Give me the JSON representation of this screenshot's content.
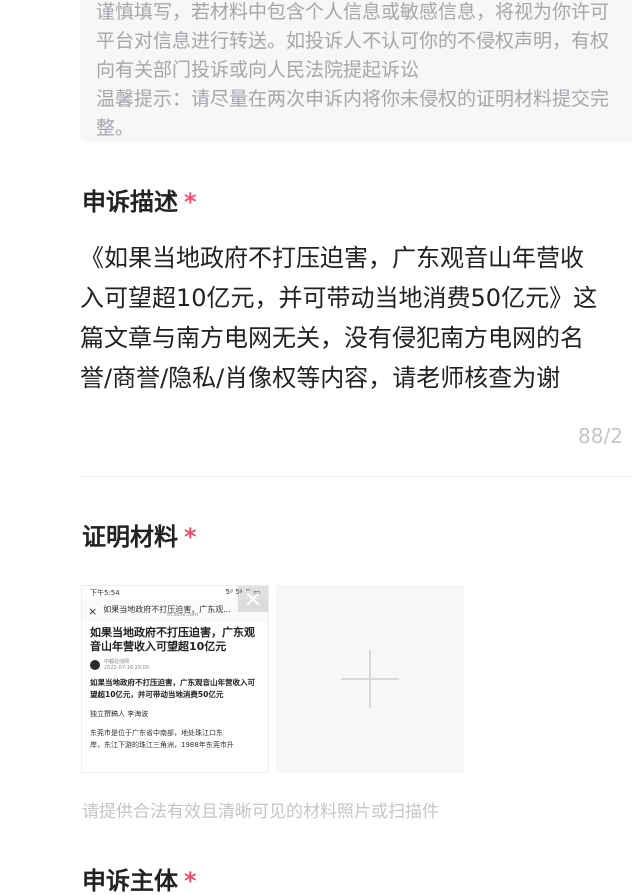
{
  "notice": {
    "lines": [
      "谨慎填写，若材料中包含个人信息或敏感信息，将视为你许可",
      "平台对信息进行转送。如投诉人不认可你的不侵权声明，有权",
      "向有关部门投诉或向人民法院提起诉讼",
      "温馨提示：请尽量在两次申诉内将你未侵权的证明材料提交完",
      "整。"
    ]
  },
  "appeal_description": {
    "title": "申诉描述",
    "required_mark": "*",
    "text_lines": [
      "《如果当地政府不打压迫害，广东观音山年营收",
      "入可望超10亿元，并可带动当地消费50亿元》这",
      "篇文章与南方电网无关，没有侵犯南方电网的名",
      "誉/商誉/隐私/肖像权等内容，请老师核查为谢"
    ],
    "char_counter": "88/2"
  },
  "proof_material": {
    "title": "证明材料",
    "required_mark": "*",
    "thumbnail": {
      "status_time": "下午5:54",
      "status_icons": "5ᵍ 5ᵍ ⌔ ▭",
      "nav_close": "×",
      "nav_title": "如果当地政府不打压迫害，广东观...",
      "nav_url": "m.sohu.com",
      "article_title": "如果当地政府不打压迫害，广东观音山年营收入可望超10亿元",
      "author_name": "中都在线网",
      "author_date": "2022-07-16 20:00",
      "summary": "如果当地政府不打压迫害，广东观音山年营收入可望超10亿元，并可带动当地消费50亿元",
      "byline": "独立撰稿人 李海波",
      "body_lines": [
        "东莞市是位于广东省中南部，地处珠江口东",
        "岸，东江下游的珠江三角洲，1988年东莞市升"
      ]
    },
    "hint": "请提供合法有效且清晰可见的材料照片或扫描件"
  },
  "appeal_subject": {
    "title": "申诉主体",
    "required_mark": "*"
  },
  "icons": {
    "remove_image": "close-icon",
    "add_image": "plus-icon"
  },
  "colors": {
    "required": "#f0506e",
    "placeholder": "#c5c5c8",
    "notice_bg": "#f7f7f8"
  }
}
